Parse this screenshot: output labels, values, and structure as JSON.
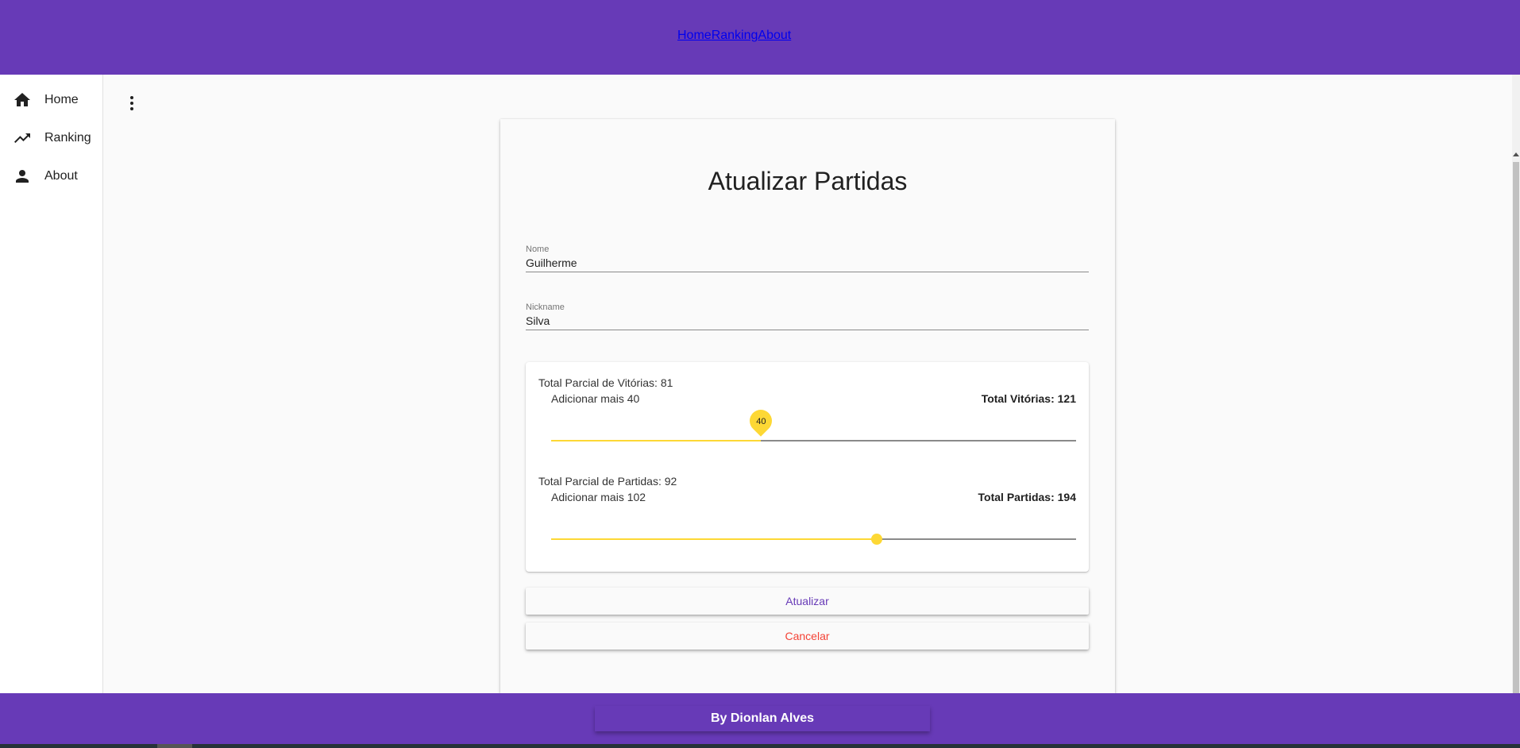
{
  "topnav": {
    "items": [
      {
        "label": "Home"
      },
      {
        "label": "Ranking"
      },
      {
        "label": "About"
      }
    ]
  },
  "sidebar": {
    "items": [
      {
        "label": "Home",
        "icon": "home-icon"
      },
      {
        "label": "Ranking",
        "icon": "trending-up-icon"
      },
      {
        "label": "About",
        "icon": "person-icon"
      }
    ]
  },
  "card": {
    "title": "Atualizar Partidas",
    "fields": {
      "nome": {
        "label": "Nome",
        "value": "Guilherme"
      },
      "nickname": {
        "label": "Nickname",
        "value": "Silva"
      }
    },
    "vitorias": {
      "partial": "Total Parcial de Vitórias: 81",
      "add": "Adicionar mais 40",
      "total": "Total Vitórias: 121",
      "slider_value": "40",
      "slider_fraction": 0.4
    },
    "partidas": {
      "partial": "Total Parcial de Partidas: 92",
      "add": "Adicionar mais 102",
      "total": "Total Partidas: 194",
      "slider_fraction": 0.62
    },
    "buttons": {
      "update": "Atualizar",
      "cancel": "Cancelar"
    }
  },
  "footer": {
    "text": "By Dionlan Alves"
  },
  "colors": {
    "primary": "#673ab7",
    "accent": "#fdd835",
    "warn": "#f44336"
  }
}
